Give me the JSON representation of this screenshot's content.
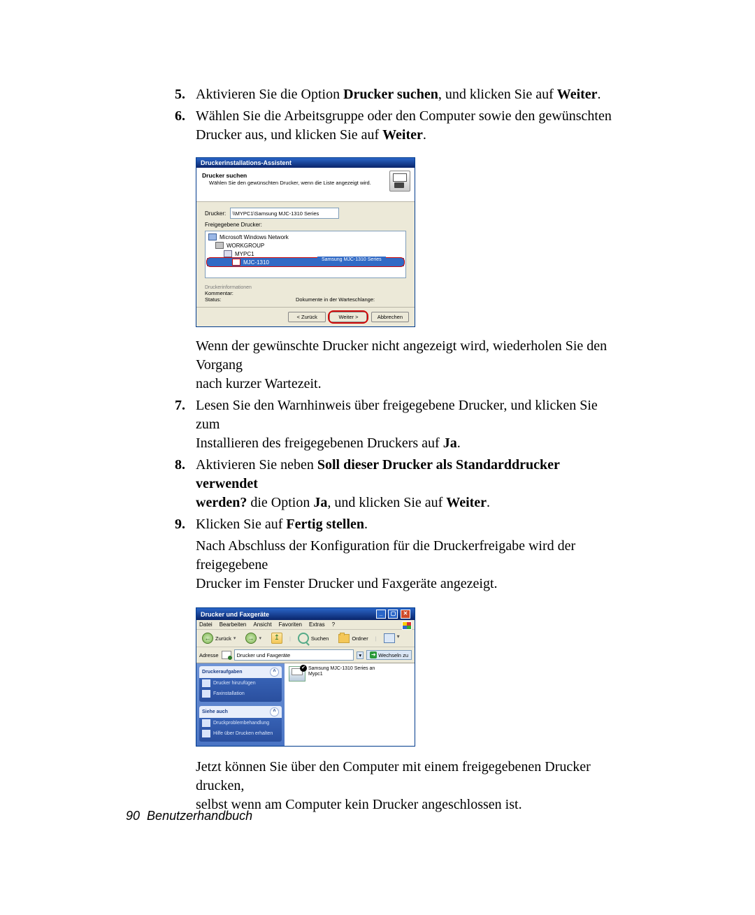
{
  "footer": {
    "page_no": "90",
    "book": "Benutzerhandbuch"
  },
  "steps": {
    "s5": {
      "num": "5.",
      "pre": "Aktivieren Sie die Option ",
      "b1": "Drucker suchen",
      "mid": ", und klicken Sie auf ",
      "b2": "Weiter",
      "post": "."
    },
    "s6": {
      "num": "6.",
      "line1a": "Wählen Sie die Arbeitsgruppe oder den Computer sowie den gewünschten",
      "line2a": "Drucker aus, und klicken Sie auf ",
      "line2b": "Weiter",
      "line2c": "."
    },
    "s6_after": {
      "l1": "Wenn der gewünschte Drucker nicht angezeigt wird, wiederholen Sie den Vorgang",
      "l2": "nach kurzer Wartezeit."
    },
    "s7": {
      "num": "7.",
      "l1": "Lesen Sie den Warnhinweis über freigegebene Drucker, und klicken Sie zum",
      "l2a": "Installieren des freigegebenen Druckers auf ",
      "l2b": "Ja",
      "l2c": "."
    },
    "s8": {
      "num": "8.",
      "l1a": "Aktivieren Sie neben ",
      "l1b": "Soll dieser Drucker als Standarddrucker verwendet",
      "l2a": "werden?",
      "l2b": " die Option ",
      "l2c": "Ja",
      "l2d": ", und klicken Sie auf ",
      "l2e": "Weiter",
      "l2f": "."
    },
    "s9": {
      "num": "9.",
      "l1a": "Klicken Sie auf ",
      "l1b": "Fertig stellen",
      "l1c": "."
    },
    "s9_after": {
      "l1": "Nach Abschluss der Konfiguration für die Druckerfreigabe wird der freigegebene",
      "l2a": "Drucker im Fenster ",
      "l2b": "Drucker und Faxgeräte",
      "l2c": " angezeigt."
    },
    "tail": {
      "l1": "Jetzt können Sie über den Computer mit einem freigegebenen Drucker drucken,",
      "l2": "selbst wenn am Computer kein Drucker angeschlossen ist."
    }
  },
  "fig1": {
    "title": "Druckerinstallations-Assistent",
    "h1": "Drucker suchen",
    "h2": "Wählen Sie den gewünschten Drucker, wenn die Liste angezeigt wird.",
    "printer_label": "Drucker:",
    "printer_value": "\\\\MYPC1\\Samsung MJC-1310 Series",
    "shared_label": "Freigegebene Drucker:",
    "tree": {
      "root": "Microsoft Windows Network",
      "workgroup": "WORKGROUP",
      "pc": "MYPC1",
      "selected": "MJC-1310",
      "selected_desc": "Samsung MJC-1310 Series"
    },
    "info_header": "Druckerinformationen",
    "comment_label": "Kommentar:",
    "status_label": "Status:",
    "queue_label": "Dokumente in der Warteschlange:",
    "buttons": {
      "back": "< Zurück",
      "next": "Weiter >",
      "cancel": "Abbrechen"
    }
  },
  "fig2": {
    "title": "Drucker und Faxgeräte",
    "menus": {
      "file": "Datei",
      "edit": "Bearbeiten",
      "view": "Ansicht",
      "fav": "Favoriten",
      "extras": "Extras",
      "help": "?"
    },
    "toolbar": {
      "back": "Zurück",
      "search": "Suchen",
      "folders": "Ordner"
    },
    "address": {
      "label": "Adresse",
      "value": "Drucker und Faxgeräte",
      "go": "Wechseln zu"
    },
    "side": {
      "tasks_header": "Druckeraufgaben",
      "task_add": "Drucker hinzufügen",
      "task_fax": "Faxinstallation",
      "see_also_header": "Siehe auch",
      "see_trouble": "Druckproblembehandlung",
      "see_help": "Hilfe über Drucken erhalten"
    },
    "printer": {
      "name": "Samsung MJC-1310 Series an",
      "host": "Mypc1"
    }
  }
}
